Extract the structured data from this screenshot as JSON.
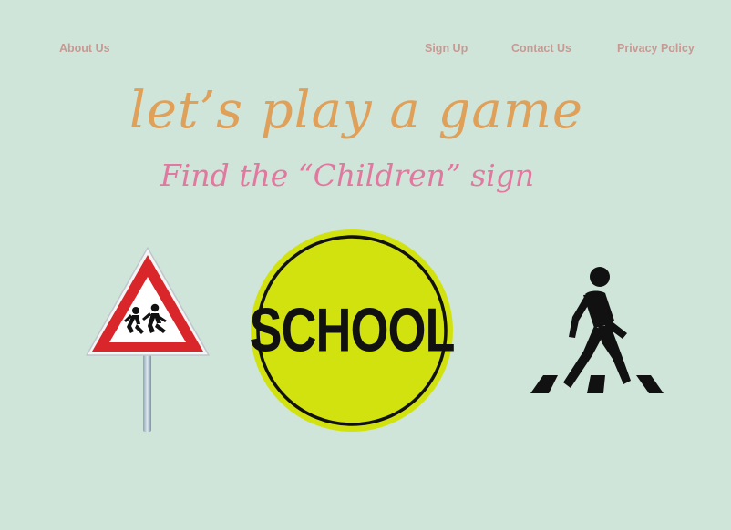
{
  "nav": {
    "about": "About Us",
    "signup": "Sign Up",
    "contact": "Contact Us",
    "privacy": "Privacy Policy"
  },
  "heading": {
    "title": "let’s play a game",
    "subtitle": "Find the “Children” sign"
  },
  "signs": {
    "school_text": "SCHOOL",
    "children_icon": "children-crossing-sign-icon",
    "school_icon": "school-sign-icon",
    "pedestrian_icon": "pedestrian-crossing-icon"
  },
  "colors": {
    "background": "#cfe5da",
    "nav": "#c69a93",
    "title": "#dfa05a",
    "subtitle": "#e0799f",
    "school_sign": "#d2e20f",
    "warning_red": "#d9262b"
  }
}
